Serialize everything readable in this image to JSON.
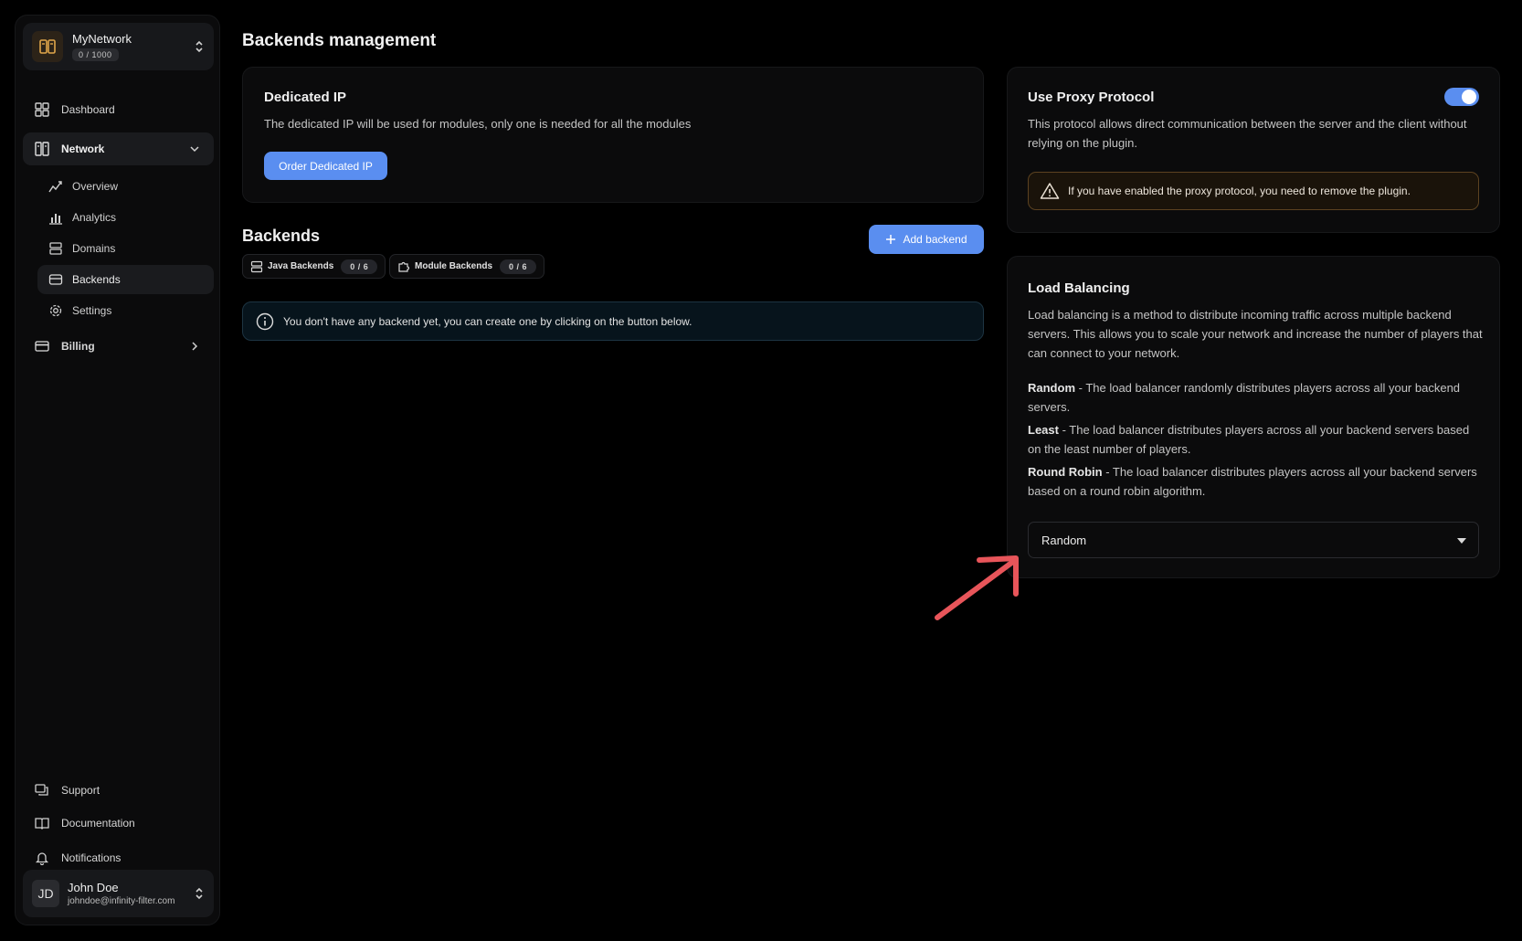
{
  "sidebar": {
    "network_name": "MyNetwork",
    "network_count": "0 / 1000",
    "items": {
      "dashboard": "Dashboard",
      "network": "Network",
      "overview": "Overview",
      "analytics": "Analytics",
      "domains": "Domains",
      "backends": "Backends",
      "settings": "Settings",
      "billing": "Billing",
      "support": "Support",
      "documentation": "Documentation",
      "notifications": "Notifications"
    },
    "user": {
      "initials": "JD",
      "name": "John Doe",
      "email": "johndoe@infinity-filter.com"
    }
  },
  "main": {
    "title": "Backends management",
    "dedicated_ip": {
      "title": "Dedicated IP",
      "description": "The dedicated IP will be used for modules, only one is needed for all the modules",
      "button": "Order Dedicated IP"
    },
    "backends": {
      "title": "Backends",
      "add_button": "Add backend",
      "java_label": "Java Backends",
      "java_count": "0 / 6",
      "module_label": "Module Backends",
      "module_count": "0 / 6",
      "empty_message": "You don't have any backend yet, you can create one by clicking on the button below."
    }
  },
  "proxy": {
    "title": "Use Proxy Protocol",
    "enabled": true,
    "description": "This protocol allows direct communication between the server and the client without relying on the plugin.",
    "warning": "If you have enabled the proxy protocol, you need to remove the plugin."
  },
  "load_balancing": {
    "title": "Load Balancing",
    "description": "Load balancing is a method to distribute incoming traffic across multiple backend servers. This allows you to scale your network and increase the number of players that can connect to your network.",
    "options": [
      {
        "name": "Random",
        "text": " - The load balancer randomly distributes players across all your backend servers."
      },
      {
        "name": "Least",
        "text": " - The load balancer distributes players across all your backend servers based on the least number of players."
      },
      {
        "name": "Round Robin",
        "text": " - The load balancer distributes players across all your backend servers based on a round robin algorithm."
      }
    ],
    "selected": "Random"
  },
  "colors": {
    "accent": "#5a8ef0",
    "annotation_arrow": "#e8555a",
    "warning_border": "#5c4220"
  }
}
